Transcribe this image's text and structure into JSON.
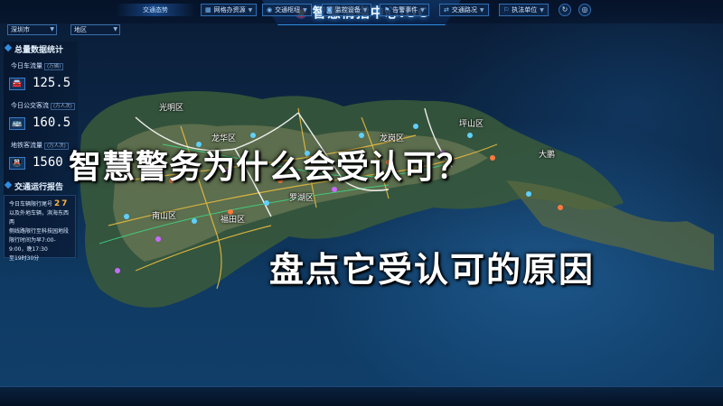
{
  "header": {
    "title": "智慧情指中心IOC",
    "city_select": "深圳市",
    "district_select": "地区"
  },
  "left_panel": {
    "section_title": "总量数据统计",
    "stats": [
      {
        "label": "今日车流量",
        "unit": "(万辆)",
        "value": "125.5",
        "icon": "car-icon"
      },
      {
        "label": "今日公交客流",
        "unit": "(万人次)",
        "value": "160.5",
        "icon": "bus-icon"
      },
      {
        "label": "地铁客流量",
        "unit": "(万人次)",
        "value": "1560",
        "icon": "metro-icon"
      }
    ],
    "traffic_section_title": "交通运行报告",
    "notice_line_1": "今日车辆限行尾号",
    "notice_digit_1": "2",
    "notice_digit_2": "7",
    "notice_line_2": "以及外地车辆，滨海东西两",
    "notice_line_3": "侧线路限行至科技园地段",
    "notice_line_4": "限行时间为早7:00-9:00，晚17:30",
    "notice_line_5": "至19时30分"
  },
  "districts": [
    "光明区",
    "龙华区",
    "龙岗区",
    "坪山区",
    "大鹏",
    "南山区",
    "福田区",
    "罗湖区"
  ],
  "overlay": {
    "headline_1": "智慧警务为什么会受认可？",
    "headline_2": "盘点它受认可的原因"
  },
  "toolbar": {
    "first_label": "交通态势",
    "buttons": [
      "网格办资源",
      "交通枢纽",
      "监控设备",
      "告警事件",
      "交通路况",
      "执法单位"
    ]
  },
  "colors": {
    "accent": "#2f8ce0",
    "highlight": "#ffb347"
  }
}
